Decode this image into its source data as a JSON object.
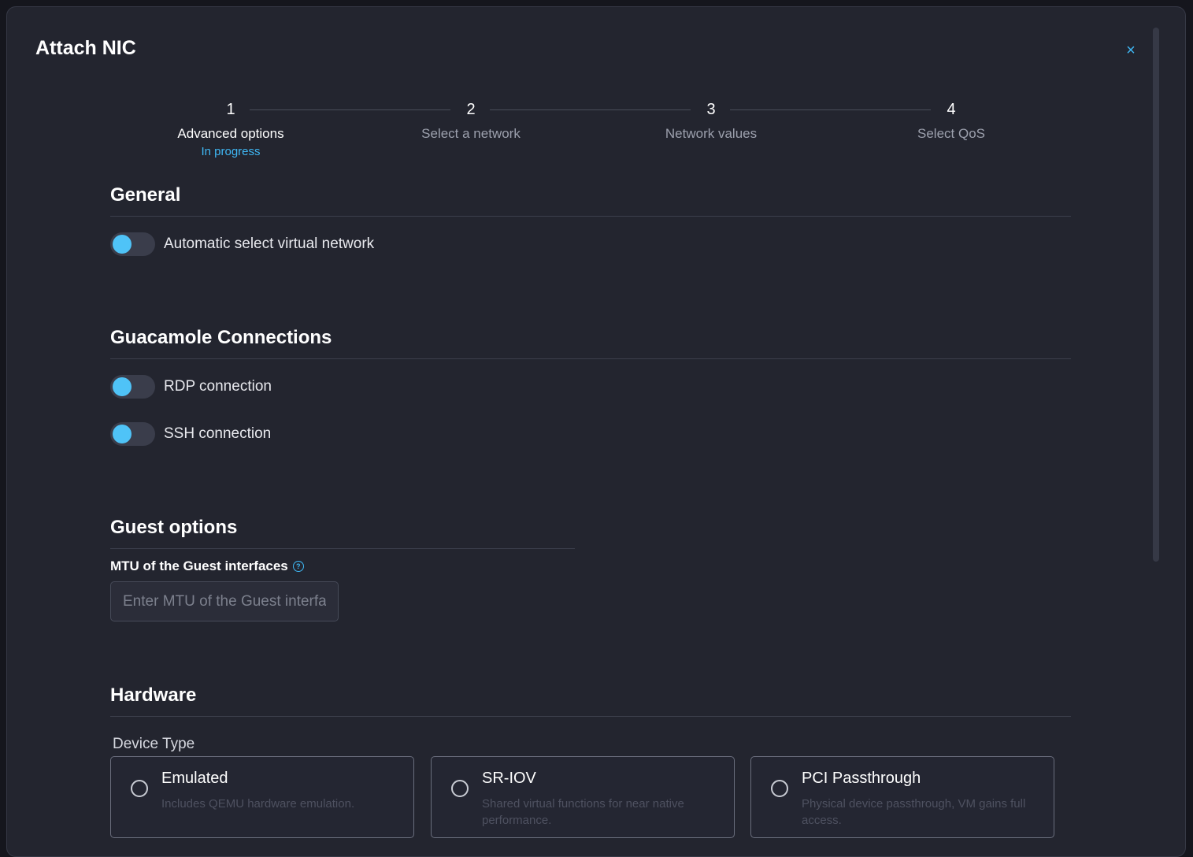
{
  "modal": {
    "title": "Attach NIC",
    "close_icon": "×"
  },
  "stepper": [
    {
      "number": "1",
      "label": "Advanced options",
      "status": "In progress"
    },
    {
      "number": "2",
      "label": "Select a network"
    },
    {
      "number": "3",
      "label": "Network values"
    },
    {
      "number": "4",
      "label": "Select QoS"
    }
  ],
  "general": {
    "title": "General",
    "auto_select_label": "Automatic select virtual network"
  },
  "guacamole": {
    "title": "Guacamole Connections",
    "rdp_label": "RDP connection",
    "ssh_label": "SSH connection"
  },
  "guest": {
    "title": "Guest options",
    "mtu_label": "MTU of the Guest interfaces",
    "mtu_placeholder": "Enter MTU of the Guest interfaces",
    "mtu_value": ""
  },
  "hardware": {
    "title": "Hardware",
    "device_type_label": "Device Type",
    "options": [
      {
        "title": "Emulated",
        "description": "Includes QEMU hardware emulation."
      },
      {
        "title": "SR-IOV",
        "description": "Shared virtual functions for near native performance."
      },
      {
        "title": "PCI Passthrough",
        "description": "Physical device passthrough, VM gains full access."
      }
    ]
  },
  "colors": {
    "accent": "#3fb8f5",
    "background": "#23252f",
    "toggle_knob": "#4fc3f7"
  }
}
